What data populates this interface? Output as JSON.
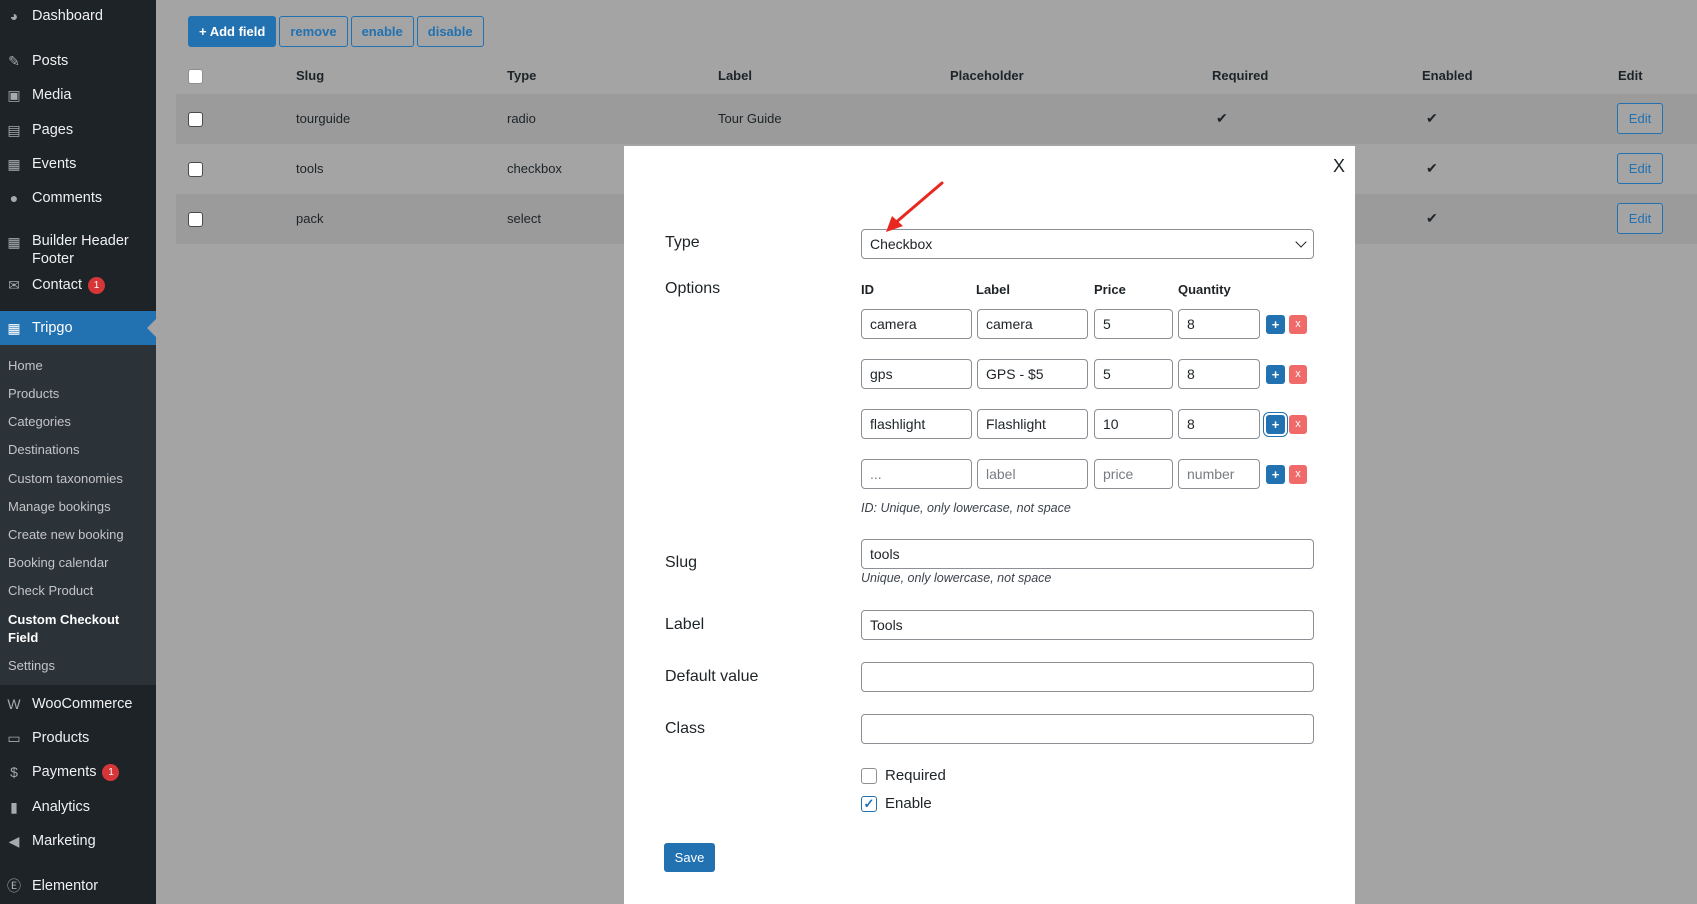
{
  "sidebar": {
    "items": [
      {
        "label": "Dashboard",
        "icon": "dashboard-icon"
      },
      {
        "label": "Posts",
        "icon": "pin-icon"
      },
      {
        "label": "Media",
        "icon": "media-icon"
      },
      {
        "label": "Pages",
        "icon": "pages-icon"
      },
      {
        "label": "Events",
        "icon": "calendar-icon"
      },
      {
        "label": "Comments",
        "icon": "comment-icon"
      },
      {
        "label": "Builder Header Footer",
        "icon": "grid-icon"
      },
      {
        "label": "Contact",
        "icon": "mail-icon",
        "badge": "1"
      },
      {
        "label": "Tripgo",
        "icon": "calendar-icon"
      },
      {
        "label": "WooCommerce",
        "icon": "woo-icon"
      },
      {
        "label": "Products",
        "icon": "archive-icon"
      },
      {
        "label": "Payments",
        "icon": "dollar-icon",
        "badge": "1"
      },
      {
        "label": "Analytics",
        "icon": "bar-chart-icon"
      },
      {
        "label": "Marketing",
        "icon": "megaphone-icon"
      },
      {
        "label": "Elementor",
        "icon": "elementor-icon"
      }
    ],
    "submenu": [
      "Home",
      "Products",
      "Categories",
      "Destinations",
      "Custom taxonomies",
      "Manage bookings",
      "Create new booking",
      "Booking calendar",
      "Check Product",
      "Custom Checkout Field",
      "Settings"
    ]
  },
  "toolbar": {
    "add": "+ Add field",
    "remove": "remove",
    "enable": "enable",
    "disable": "disable"
  },
  "table": {
    "headers": {
      "slug": "Slug",
      "type": "Type",
      "label": "Label",
      "placeholder": "Placeholder",
      "required": "Required",
      "enabled": "Enabled",
      "edit": "Edit"
    },
    "rows": [
      {
        "slug": "tourguide",
        "type": "radio",
        "label": "Tour Guide",
        "required": "✔",
        "enabled": "✔",
        "edit": "Edit"
      },
      {
        "slug": "tools",
        "type": "checkbox",
        "enabled": "✔",
        "edit": "Edit"
      },
      {
        "slug": "pack",
        "type": "select",
        "enabled": "✔",
        "edit": "Edit"
      }
    ]
  },
  "modal": {
    "close": "X",
    "type_label": "Type",
    "type_value": "Checkbox",
    "options_label": "Options",
    "opt_headers": {
      "id": "ID",
      "label": "Label",
      "price": "Price",
      "quantity": "Quantity"
    },
    "options": [
      {
        "id": "camera",
        "label": "camera",
        "price": "5",
        "quantity": "8"
      },
      {
        "id": "gps",
        "label": "GPS - $5",
        "price": "5",
        "quantity": "8"
      },
      {
        "id": "flashlight",
        "label": "Flashlight",
        "price": "10",
        "quantity": "8"
      }
    ],
    "placeholders": {
      "id": "...",
      "label": "label",
      "price": "price",
      "quantity": "number"
    },
    "plus": "+",
    "minus": "x",
    "id_hint": "ID: Unique, only lowercase, not space",
    "slug_label": "Slug",
    "slug_value": "tools",
    "slug_hint": "Unique, only lowercase, not space",
    "label_label": "Label",
    "label_value": "Tools",
    "default_label": "Default value",
    "default_value": "",
    "class_label": "Class",
    "class_value": "",
    "required_label": "Required",
    "required_checked": false,
    "enable_label": "Enable",
    "enable_checked": true,
    "save": "Save"
  },
  "colors": {
    "accent": "#2271b1",
    "sidebar": "#1d2327",
    "badge": "#d63638",
    "delete": "#f06a6a",
    "annotation_arrow": "#e8281f"
  }
}
